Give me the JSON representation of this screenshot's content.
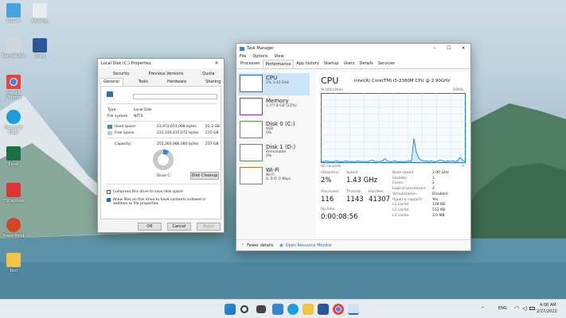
{
  "desktop_icons": [
    {
      "label": "This PC",
      "color": "#4aa3df"
    },
    {
      "label": "Desktop",
      "color": "#e9ecf0"
    },
    {
      "label": "Recycle Bin",
      "color": "#cfd8de"
    },
    {
      "label": "Word",
      "color": "#2b579a"
    },
    {
      "label": "Google Chrome",
      "color": "#e8453c"
    },
    {
      "label": "Microsoft Edge",
      "color": "#1a9fda"
    },
    {
      "label": "Excel",
      "color": "#1d7044"
    },
    {
      "label": "FSCapture",
      "color": "#d33"
    },
    {
      "label": "PowerPoint",
      "color": "#d24726"
    },
    {
      "label": "Tool",
      "color": "#f0c34a"
    }
  ],
  "properties": {
    "title": "Local Disk (C:) Properties",
    "tabs_row1": [
      "Security",
      "Previous Versions",
      "Quota"
    ],
    "tabs_row2": [
      "General",
      "Tools",
      "Hardware",
      "Sharing"
    ],
    "type_label": "Type:",
    "type_value": "Local Disk",
    "fs_label": "File system:",
    "fs_value": "NTFS",
    "used_label": "Used space:",
    "used_bytes": "23,972,651,008 bytes",
    "used_gb": "22.3 GB",
    "free_label": "Free space:",
    "free_bytes": "231,330,435,072 bytes",
    "free_gb": "215 GB",
    "cap_label": "Capacity:",
    "cap_bytes": "255,303,086,080 bytes",
    "cap_gb": "237 GB",
    "drive_label": "Drive C:",
    "cleanup": "Disk Cleanup",
    "compress": "Compress this drive to save disk space",
    "index": "Allow files on this drive to have contents indexed in addition to file properties",
    "ok": "OK",
    "cancel": "Cancel",
    "apply": "Apply",
    "used_fraction": 0.094,
    "used_color": "#2a8fd6",
    "free_color": "#c8c8c8"
  },
  "taskmgr": {
    "title": "Task Manager",
    "menu": [
      "File",
      "Options",
      "View"
    ],
    "tabs": [
      "Processes",
      "Performance",
      "App history",
      "Startup",
      "Users",
      "Details",
      "Services"
    ],
    "side": [
      {
        "title": "CPU",
        "sub1": "2% 1.43 GHz",
        "sub2": "",
        "color": "#1174c8"
      },
      {
        "title": "Memory",
        "sub1": "1.7/7.8 GB (22%)",
        "sub2": "",
        "color": "#9b2d9b"
      },
      {
        "title": "Disk 0 (C:)",
        "sub1": "SSD",
        "sub2": "0%",
        "color": "#4da03f"
      },
      {
        "title": "Disk 1 (D:)",
        "sub1": "Removable",
        "sub2": "0%",
        "color": "#4da03f"
      },
      {
        "title": "Wi-Fi",
        "sub1": "Wi-Fi",
        "sub2": "S: 0 R: 0 Kbps",
        "color": "#b3772a"
      }
    ],
    "cpu_title": "CPU",
    "cpu_model": "Intel(R) Core(TM) i5-3380M CPU @ 2.90GHz",
    "util_label": "% Utilization",
    "util_max": "100%",
    "seconds": "60 seconds",
    "zero": "0",
    "utilization_label": "Utilization",
    "utilization": "2%",
    "speed_label": "Speed",
    "speed": "1.43 GHz",
    "processes_label": "Processes",
    "processes": "116",
    "threads_label": "Threads",
    "threads": "1143",
    "handles_label": "Handles",
    "handles": "41307",
    "uptime_label": "Up time",
    "uptime": "0:00:08:56",
    "details": [
      [
        "Base speed:",
        "2.90 GHz"
      ],
      [
        "Sockets:",
        "1"
      ],
      [
        "Cores:",
        "2"
      ],
      [
        "Logical processors:",
        "4"
      ],
      [
        "Virtualization:",
        "Disabled"
      ],
      [
        "Hyper-V support:",
        "Yes"
      ],
      [
        "L1 cache:",
        "128 KB"
      ],
      [
        "L2 cache:",
        "512 KB"
      ],
      [
        "L3 cache:",
        "3.0 MB"
      ]
    ],
    "fewer": "Fewer details",
    "monitor": "Open Resource Monitor",
    "graph_values": [
      1,
      1,
      2,
      1,
      1,
      1,
      2,
      1,
      1,
      1,
      2,
      1,
      1,
      1,
      1,
      2,
      1,
      1,
      1,
      1,
      2,
      3,
      1,
      1,
      1,
      2,
      5,
      2,
      1,
      1,
      2,
      1,
      1,
      1,
      1,
      1,
      2,
      1,
      35,
      14,
      6,
      3,
      2,
      2,
      1,
      2,
      1,
      1,
      2,
      3,
      2,
      1,
      2,
      1,
      2,
      1,
      2,
      7,
      3,
      1
    ]
  },
  "taskbar": {
    "time": "4:08 AM",
    "date": "2/27/2022",
    "lang": "ENG",
    "apps": [
      "start",
      "search",
      "taskview",
      "widgets",
      "edge",
      "explorer",
      "word",
      "chrome",
      "taskmgr"
    ]
  }
}
